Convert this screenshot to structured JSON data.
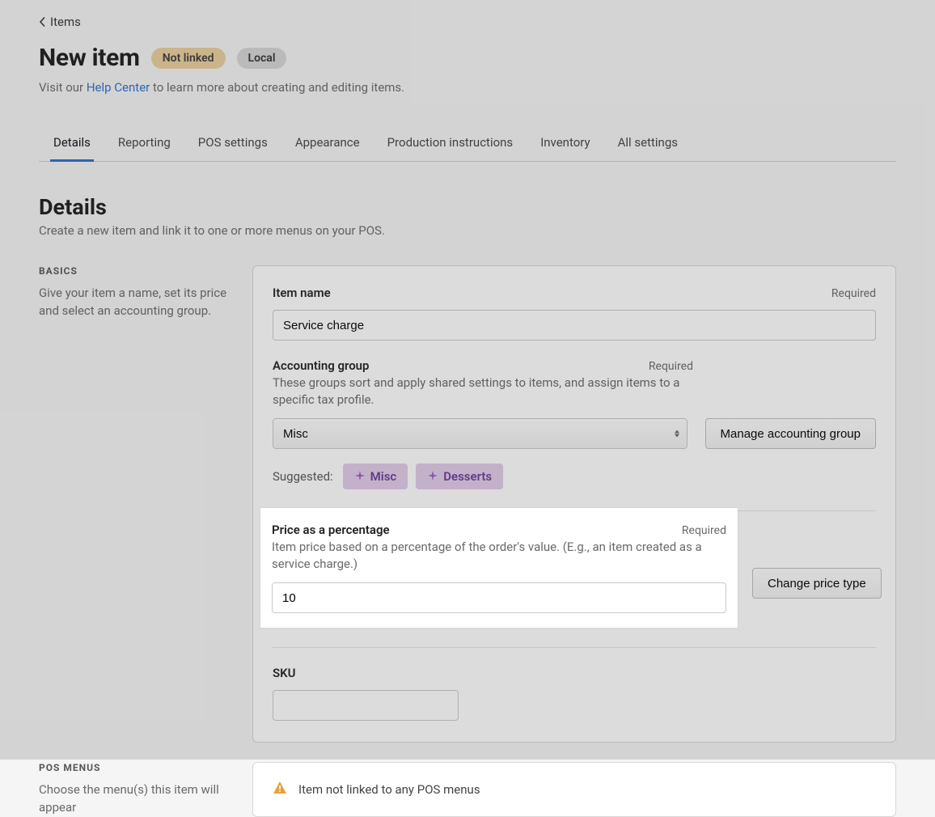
{
  "breadcrumb": {
    "back_label": "Items"
  },
  "header": {
    "title": "New item",
    "badge_not_linked": "Not linked",
    "badge_local": "Local",
    "sub_prefix": "Visit our ",
    "help_link": "Help Center",
    "sub_suffix": " to learn more about creating and editing items."
  },
  "tabs": [
    {
      "label": "Details",
      "active": true
    },
    {
      "label": "Reporting"
    },
    {
      "label": "POS settings"
    },
    {
      "label": "Appearance"
    },
    {
      "label": "Production instructions"
    },
    {
      "label": "Inventory"
    },
    {
      "label": "All settings"
    }
  ],
  "section": {
    "title": "Details",
    "sub": "Create a new item and link it to one or more menus on your POS."
  },
  "basics": {
    "heading": "BASICS",
    "desc": "Give your item a name, set its price and select an accounting group.",
    "item_name_label": "Item name",
    "required": "Required",
    "item_name_value": "Service charge",
    "acct_label": "Accounting group",
    "acct_desc": "These groups sort and apply shared settings to items, and assign items to a specific tax profile.",
    "acct_value": "Misc",
    "manage_btn": "Manage accounting group",
    "suggested_label": "Suggested:",
    "chips": [
      "Misc",
      "Desserts"
    ],
    "price_label": "Price as a percentage",
    "price_desc": "Item price based on a percentage of the order's value. (E.g., an item created as a service charge.)",
    "price_value": "10",
    "change_price_btn": "Change price type",
    "sku_label": "SKU",
    "sku_value": ""
  },
  "pos_menus": {
    "heading": "POS MENUS",
    "desc": "Choose the menu(s) this item will appear",
    "notice": "Item not linked to any POS menus"
  }
}
